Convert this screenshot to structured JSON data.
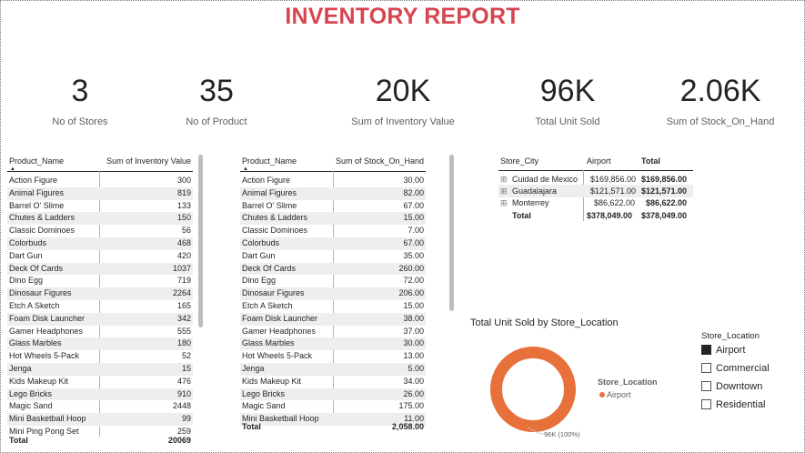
{
  "report": {
    "title": "INVENTORY REPORT"
  },
  "kpis": [
    {
      "value": "3",
      "label": "No of Stores"
    },
    {
      "value": "35",
      "label": "No of Product"
    },
    {
      "value": "20K",
      "label": "Sum of Inventory Value"
    },
    {
      "value": "96K",
      "label": "Total Unit Sold"
    },
    {
      "value": "2.06K",
      "label": "Sum of Stock_On_Hand"
    }
  ],
  "table1": {
    "col1": "Product_Name",
    "col2": "Sum of Inventory Value",
    "rows": [
      [
        "Action Figure",
        "300"
      ],
      [
        "Animal Figures",
        "819"
      ],
      [
        "Barrel O' Slime",
        "133"
      ],
      [
        "Chutes & Ladders",
        "150"
      ],
      [
        "Classic Dominoes",
        "56"
      ],
      [
        "Colorbuds",
        "468"
      ],
      [
        "Dart Gun",
        "420"
      ],
      [
        "Deck Of Cards",
        "1037"
      ],
      [
        "Dino Egg",
        "719"
      ],
      [
        "Dinosaur Figures",
        "2264"
      ],
      [
        "Etch A Sketch",
        "165"
      ],
      [
        "Foam Disk Launcher",
        "342"
      ],
      [
        "Gamer Headphones",
        "555"
      ],
      [
        "Glass Marbles",
        "180"
      ],
      [
        "Hot Wheels 5-Pack",
        "52"
      ],
      [
        "Jenga",
        "15"
      ],
      [
        "Kids Makeup Kit",
        "476"
      ],
      [
        "Lego Bricks",
        "910"
      ],
      [
        "Magic Sand",
        "2448"
      ],
      [
        "Mini Basketball Hoop",
        "99"
      ],
      [
        "Mini Ping Pong Set",
        "259"
      ]
    ],
    "total_label": "Total",
    "total_value": "20069"
  },
  "table2": {
    "col1": "Product_Name",
    "col2": "Sum of Stock_On_Hand",
    "rows": [
      [
        "Action Figure",
        "30.00"
      ],
      [
        "Animal Figures",
        "82.00"
      ],
      [
        "Barrel O' Slime",
        "67.00"
      ],
      [
        "Chutes & Ladders",
        "15.00"
      ],
      [
        "Classic Dominoes",
        "7.00"
      ],
      [
        "Colorbuds",
        "67.00"
      ],
      [
        "Dart Gun",
        "35.00"
      ],
      [
        "Deck Of Cards",
        "260.00"
      ],
      [
        "Dino Egg",
        "72.00"
      ],
      [
        "Dinosaur Figures",
        "206.00"
      ],
      [
        "Etch A Sketch",
        "15.00"
      ],
      [
        "Foam Disk Launcher",
        "38.00"
      ],
      [
        "Gamer Headphones",
        "37.00"
      ],
      [
        "Glass Marbles",
        "30.00"
      ],
      [
        "Hot Wheels 5-Pack",
        "13.00"
      ],
      [
        "Jenga",
        "5.00"
      ],
      [
        "Kids Makeup Kit",
        "34.00"
      ],
      [
        "Lego Bricks",
        "26.00"
      ],
      [
        "Magic Sand",
        "175.00"
      ],
      [
        "Mini Basketball Hoop",
        "11.00"
      ]
    ],
    "total_label": "Total",
    "total_value": "2,058.00"
  },
  "matrix": {
    "col1": "Store_City",
    "col2": "Airport",
    "col3": "Total",
    "rows": [
      {
        "city": "Cuidad de Mexico",
        "airport": "$169,856.00",
        "total": "$169,856.00"
      },
      {
        "city": "Guadalajara",
        "airport": "$121,571.00",
        "total": "$121,571.00"
      },
      {
        "city": "Monterrey",
        "airport": "$86,622.00",
        "total": "$86,622.00"
      }
    ],
    "total_label": "Total",
    "total_airport": "$378,049.00",
    "total_total": "$378,049.00",
    "expand_glyph": "⊞"
  },
  "chart_data": {
    "type": "pie",
    "title": "Total Unit Sold by Store_Location",
    "categories": [
      "Airport"
    ],
    "values": [
      96000
    ],
    "data_label": "96K (100%)",
    "inline_legend_title": "Store_Location",
    "inline_legend_item": "Airport",
    "colors": [
      "#e8703a"
    ],
    "donut": true
  },
  "slicer": {
    "title": "Store_Location",
    "items": [
      {
        "label": "Airport",
        "checked": true
      },
      {
        "label": "Commercial",
        "checked": false
      },
      {
        "label": "Downtown",
        "checked": false
      },
      {
        "label": "Residential",
        "checked": false
      }
    ]
  }
}
